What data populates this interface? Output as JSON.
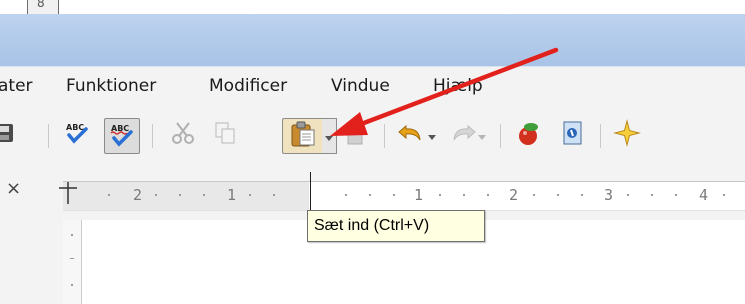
{
  "window": {
    "frame_digit": "8"
  },
  "menubar": {
    "items": [
      {
        "label": "ater"
      },
      {
        "label": "Funktioner"
      },
      {
        "label": "Modificer"
      },
      {
        "label": "Vindue"
      },
      {
        "label": "Hjælp"
      }
    ]
  },
  "toolbar": {
    "icons": [
      "save-icon",
      "spellcheck-icon",
      "autospellcheck-icon",
      "cut-icon",
      "copy-icon",
      "paste-icon",
      "paste-dropdown-icon",
      "format-paintbrush-icon",
      "undo-icon",
      "undo-dropdown-icon",
      "redo-icon",
      "redo-dropdown-icon",
      "insert-object-icon",
      "navigator-icon",
      "gallery-star-icon"
    ],
    "spell_label": "ABC"
  },
  "ruler": {
    "numbers": [
      "2",
      "1",
      "1",
      "2",
      "3",
      "4"
    ]
  },
  "tooltip": {
    "text": "Sæt ind (Ctrl+V)"
  },
  "colors": {
    "titlebar": "#b4cdea",
    "arrow": "#e3211c",
    "tooltip_bg": "#ffffe1"
  }
}
